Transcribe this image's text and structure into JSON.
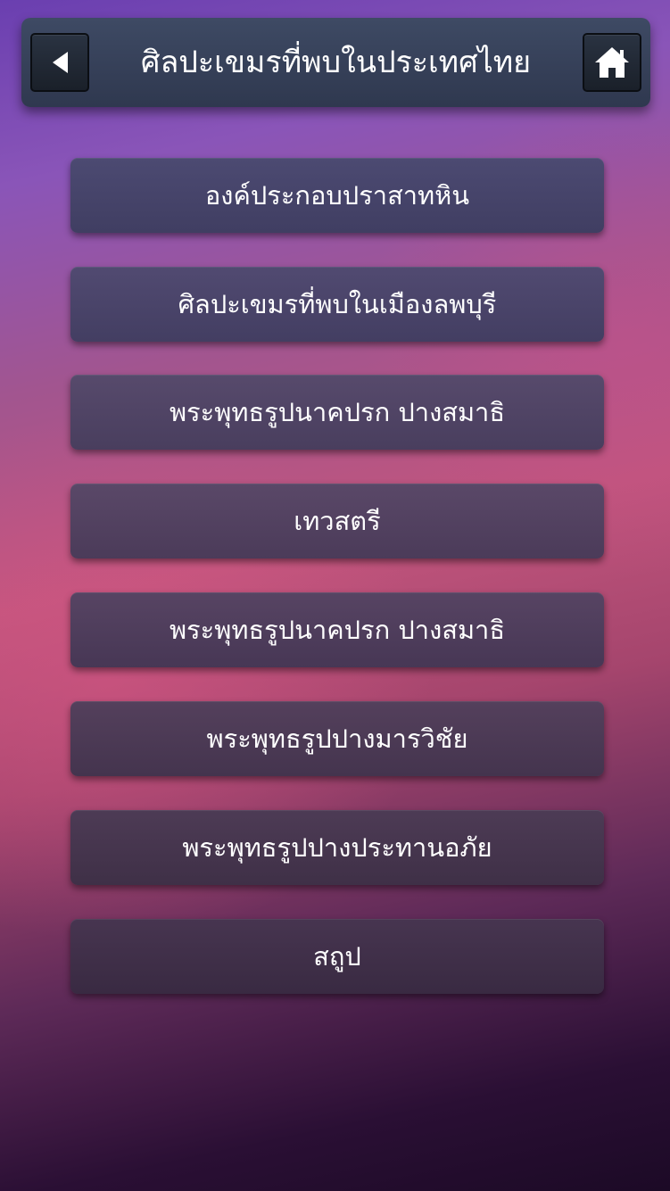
{
  "header": {
    "title": "ศิลปะเขมรที่พบในประเทศไทย",
    "back_icon": "back-triangle-icon",
    "home_icon": "home-icon"
  },
  "menu": {
    "items": [
      {
        "label": "องค์ประกอบปราสาทหิน"
      },
      {
        "label": "ศิลปะเขมรที่พบในเมืองลพบุรี"
      },
      {
        "label": "พระพุทธรูปนาคปรก ปางสมาธิ"
      },
      {
        "label": "เทวสตรี"
      },
      {
        "label": "พระพุทธรูปนาคปรก ปางสมาธิ"
      },
      {
        "label": "พระพุทธรูปปางมารวิชัย"
      },
      {
        "label": "พระพุทธรูปปางประทานอภัย"
      },
      {
        "label": "สถูป"
      }
    ]
  },
  "colors": {
    "header_bg": "#353f58",
    "button_text": "#ffffff",
    "icon_fill": "#ffffff"
  }
}
